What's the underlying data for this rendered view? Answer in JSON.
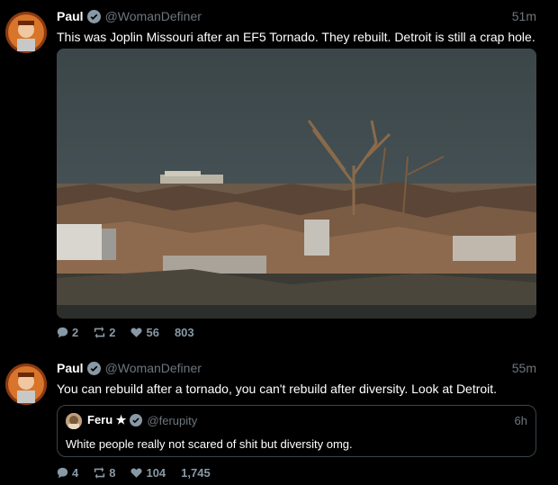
{
  "tweets": [
    {
      "author_name": "Paul",
      "author_handle": "@WomanDefiner",
      "time": "51m",
      "text": "This was Joplin Missouri after an EF5 Tornado. They rebuilt. Detroit is still a crap hole.",
      "media_description_icon": "photo",
      "replies": "2",
      "retweets": "2",
      "likes": "56",
      "views": "803"
    },
    {
      "author_name": "Paul",
      "author_handle": "@WomanDefiner",
      "time": "55m",
      "text": "You can rebuild after a tornado, you can't rebuild after diversity. Look at Detroit.",
      "quoted": {
        "author_name": "Feru ★",
        "author_handle": "@ferupity",
        "time": "6h",
        "text": "White people really not scared of shit but diversity omg."
      },
      "replies": "4",
      "retweets": "8",
      "likes": "104",
      "views": "1,745"
    }
  ],
  "colors": {
    "background": "#000000",
    "muted": "#6e767d",
    "verified": "#8899a6",
    "text": "#ffffff"
  }
}
